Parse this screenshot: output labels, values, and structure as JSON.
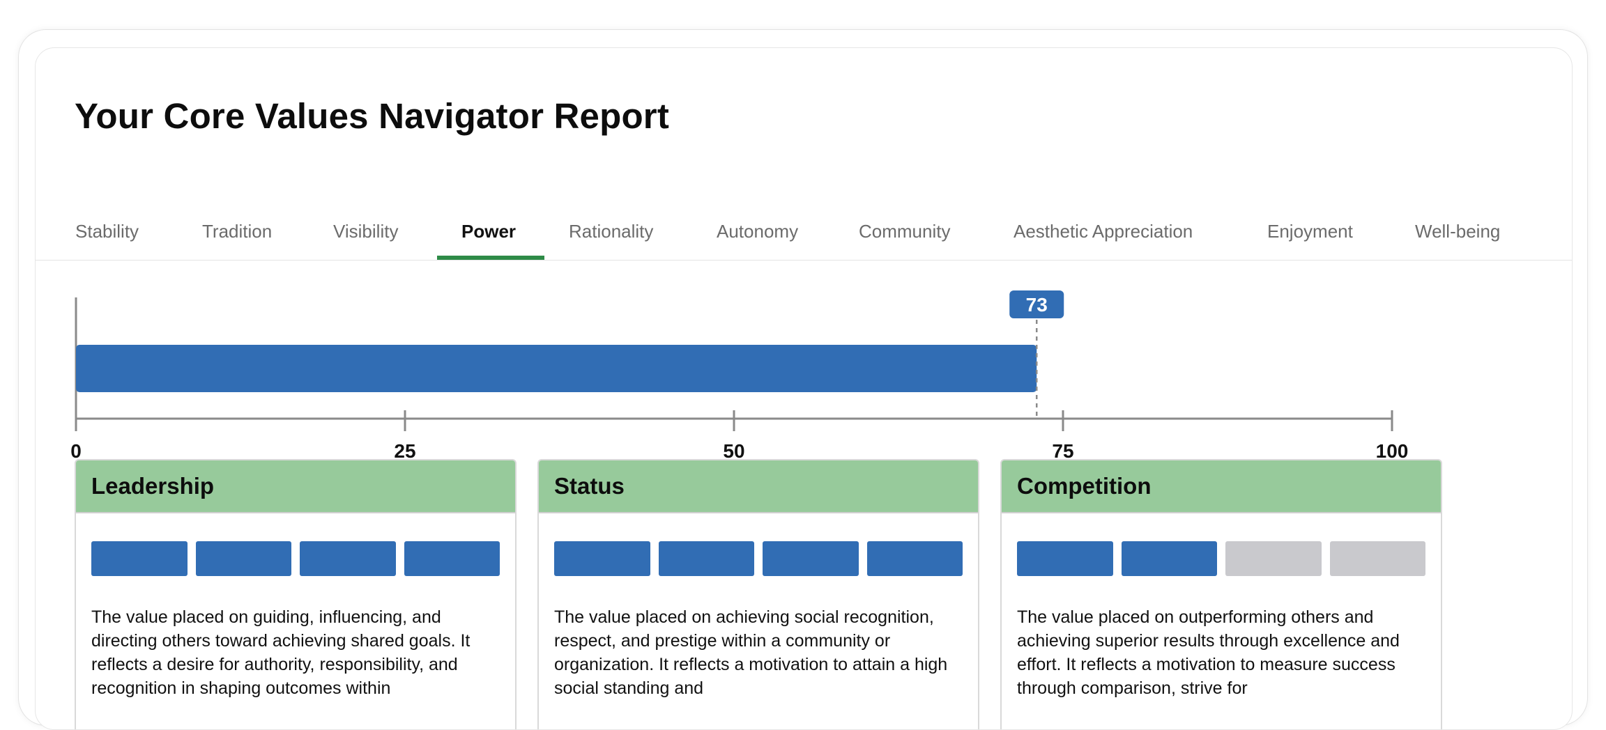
{
  "report": {
    "title": "Your Core Values Navigator Report"
  },
  "tabs": [
    {
      "label": "Stability"
    },
    {
      "label": "Tradition"
    },
    {
      "label": "Visibility"
    },
    {
      "label": "Power"
    },
    {
      "label": "Rationality"
    },
    {
      "label": "Autonomy"
    },
    {
      "label": "Community"
    },
    {
      "label": "Aesthetic Appreciation"
    },
    {
      "label": "Enjoyment"
    },
    {
      "label": "Well-being"
    }
  ],
  "active_tab": "Power",
  "chart_data": {
    "type": "bar",
    "categories": [
      "Power"
    ],
    "values": [
      73
    ],
    "xlim": [
      0,
      100
    ],
    "ticks": [
      0,
      25,
      50,
      75,
      100
    ],
    "tick_labels": [
      "0",
      "25",
      "50",
      "75",
      "100"
    ],
    "data_label": "73",
    "bar_color": "#316db4"
  },
  "subvalues": [
    {
      "title": "Leadership",
      "level": 4,
      "max": 4,
      "description": "The value placed on guiding, influencing, and directing others toward achieving shared goals. It reflects a desire for authority, responsibility, and recognition in shaping outcomes within"
    },
    {
      "title": "Status",
      "level": 4,
      "max": 4,
      "description": "The value placed on achieving social recognition, respect, and prestige within a community or organization. It reflects a motivation to attain a high social standing and"
    },
    {
      "title": "Competition",
      "level": 2,
      "max": 4,
      "description": "The value placed on outperforming others and achieving superior results through excellence and effort. It reflects a motivation to measure success through comparison, strive for"
    }
  ],
  "colors": {
    "accent_green": "#2e8b47",
    "header_green": "#97ca9b",
    "bar_blue": "#316db4",
    "segment_empty": "#c9c9cd"
  }
}
